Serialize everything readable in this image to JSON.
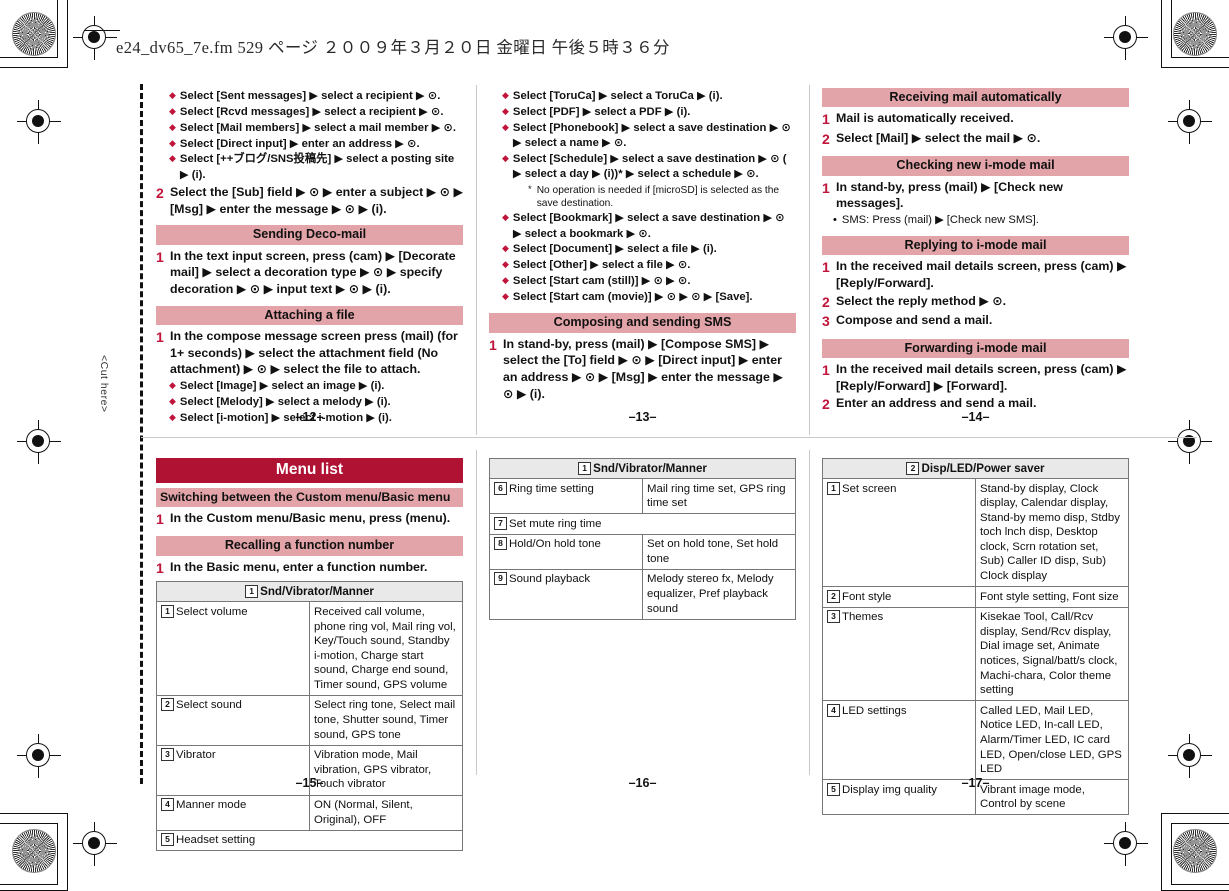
{
  "page": {
    "file_header": "e24_dv65_7e.fm   529 ページ   ２００９年３月２０日   金曜日   午後５時３６分",
    "cut_here_label": "<Cut here>",
    "accent_pink": "#E2A4A8",
    "accent_red": "#B01234",
    "marker_red": "#C0143A"
  },
  "folios": {
    "p12": "–12–",
    "p13": "–13–",
    "p14": "–14–",
    "p15": "–15–",
    "p16": "–16–",
    "p17": "–17–"
  },
  "col1_top": {
    "lead_bullets": [
      "Select [Sent messages] ▶ select a recipient ▶ ⊙.",
      "Select [Rcvd messages] ▶ select a recipient ▶ ⊙.",
      "Select [Mail members] ▶ select a mail member ▶ ⊙.",
      "Select [Direct input] ▶ enter an address ▶ ⊙.",
      "Select [++ブログ/SNS投稿先] ▶ select a posting site ▶ (i)."
    ],
    "step2": {
      "num": "2",
      "text": "Select the [Sub] field ▶ ⊙ ▶ enter a subject ▶ ⊙ ▶ [Msg] ▶ enter the message ▶ ⊙ ▶ (i)."
    },
    "deco": {
      "heading": "Sending Deco-mail",
      "step1_num": "1",
      "step1_text": "In the text input screen, press (cam) ▶ [Decorate mail] ▶ select a decoration type ▶ ⊙ ▶ specify decoration ▶ ⊙ ▶ input text ▶ ⊙ ▶ (i)."
    },
    "attach": {
      "heading": "Attaching a file",
      "step1_num": "1",
      "step1_text": "In the compose message screen press (mail) (for 1+ seconds) ▶ select the attachment field (No attachment) ▶ ⊙ ▶ select the file to attach.",
      "bullets": [
        "Select [Image] ▶ select an image ▶ (i).",
        "Select [Melody] ▶ select a melody ▶ (i).",
        "Select [i-motion] ▶ select i-motion ▶ (i)."
      ]
    }
  },
  "col2_top": {
    "bullets": [
      "Select [ToruCa] ▶ select a ToruCa ▶ (i).",
      "Select [PDF] ▶ select a PDF ▶ (i).",
      "Select [Phonebook] ▶ select a save destination ▶ ⊙ ▶ select a name ▶ ⊙.",
      "Select [Schedule] ▶ select a save destination ▶ ⊙ ( ▶ select a day ▶ (i))* ▶ select a schedule ▶ ⊙.",
      "Select [Bookmark] ▶ select a save destination ▶ ⊙ ▶ select a bookmark ▶ ⊙.",
      "Select [Document] ▶ select a file ▶ (i).",
      "Select [Other] ▶ select a file ▶ ⊙.",
      "Select [Start cam (still)] ▶ ⊙ ▶ ⊙.",
      "Select [Start cam (movie)] ▶ ⊙ ▶ ⊙ ▶ [Save]."
    ],
    "footnote_mark": "*",
    "footnote_text": "No operation is needed if [microSD] is selected as the save destination.",
    "sms": {
      "heading": "Composing and sending SMS",
      "step1_num": "1",
      "step1_text": "In stand-by, press (mail) ▶ [Compose SMS] ▶ select the [To] field ▶ ⊙ ▶ [Direct input] ▶ enter an address ▶ ⊙ ▶ [Msg] ▶ enter the message ▶ ⊙ ▶ (i)."
    }
  },
  "col3_top": {
    "receiving": {
      "heading": "Receiving mail automatically",
      "steps": [
        {
          "num": "1",
          "text": "Mail is automatically received."
        },
        {
          "num": "2",
          "text": "Select [Mail] ▶ select the mail ▶ ⊙."
        }
      ]
    },
    "checking": {
      "heading": "Checking new i-mode mail",
      "step1_num": "1",
      "step1_text": "In stand-by, press (mail) ▶ [Check new messages].",
      "bullet": "SMS: Press (mail) ▶ [Check new SMS]."
    },
    "replying": {
      "heading": "Replying to i-mode mail",
      "steps": [
        {
          "num": "1",
          "text": "In the received mail details screen, press (cam) ▶ [Reply/Forward]."
        },
        {
          "num": "2",
          "text": "Select the reply method ▶ ⊙."
        },
        {
          "num": "3",
          "text": "Compose and send a mail."
        }
      ]
    },
    "forwarding": {
      "heading": "Forwarding i-mode mail",
      "steps": [
        {
          "num": "1",
          "text": "In the received mail details screen, press (cam) ▶ [Reply/Forward] ▶ [Forward]."
        },
        {
          "num": "2",
          "text": "Enter an address and send a mail."
        }
      ]
    }
  },
  "col1_bottom": {
    "title": "Menu list",
    "switching": {
      "heading": "Switching between the Custom menu/Basic menu",
      "step1_num": "1",
      "step1_text": "In the Custom menu/Basic menu, press (menu)."
    },
    "recalling": {
      "heading": "Recalling a function number",
      "step1_num": "1",
      "step1_text": "In the Basic menu, enter a function number."
    },
    "table": {
      "header_num": "1",
      "header": "Snd/Vibrator/Manner",
      "rows": [
        {
          "num": "1",
          "label": "Select volume",
          "value": "Received call volume, phone ring vol, Mail ring vol, Key/Touch sound, Standby i-motion, Charge start sound, Charge end sound, Timer sound, GPS volume"
        },
        {
          "num": "2",
          "label": "Select sound",
          "value": "Select ring tone, Select mail tone, Shutter sound, Timer sound, GPS tone"
        },
        {
          "num": "3",
          "label": "Vibrator",
          "value": "Vibration mode, Mail vibration, GPS vibrator, Touch vibrator"
        },
        {
          "num": "4",
          "label": "Manner mode",
          "value": "ON (Normal, Silent, Original), OFF"
        },
        {
          "num": "5",
          "label": "Headset setting",
          "value": "",
          "span": true
        }
      ]
    }
  },
  "col2_bottom": {
    "table": {
      "header_num": "1",
      "header": "Snd/Vibrator/Manner",
      "rows": [
        {
          "num": "6",
          "label": "Ring time setting",
          "value": "Mail ring time set, GPS ring time set"
        },
        {
          "num": "7",
          "label": "Set mute ring time",
          "value": "",
          "span": true
        },
        {
          "num": "8",
          "label": "Hold/On hold tone",
          "value": "Set on hold tone, Set hold tone"
        },
        {
          "num": "9",
          "label": "Sound playback",
          "value": "Melody stereo fx, Melody equalizer, Pref playback sound"
        }
      ]
    }
  },
  "col3_bottom": {
    "table": {
      "header_num": "2",
      "header": "Disp/LED/Power saver",
      "rows": [
        {
          "num": "1",
          "label": "Set screen",
          "value": "Stand-by display, Clock display, Calendar display, Stand-by memo disp, Stdby toch lnch disp, Desktop clock, Scrn rotation set, Sub) Caller ID disp, Sub) Clock display"
        },
        {
          "num": "2",
          "label": "Font style",
          "value": "Font style setting, Font size"
        },
        {
          "num": "3",
          "label": "Themes",
          "value": "Kisekae Tool, Call/Rcv display, Send/Rcv display, Dial image set, Animate notices, Signal/batt/s clock, Machi-chara, Color theme setting"
        },
        {
          "num": "4",
          "label": "LED settings",
          "value": "Called LED, Mail LED, Notice LED, In-call LED, Alarm/Timer LED, IC card LED, Open/close LED, GPS LED"
        },
        {
          "num": "5",
          "label": "Display img quality",
          "value": "Vibrant image mode, Control by scene"
        }
      ]
    }
  }
}
